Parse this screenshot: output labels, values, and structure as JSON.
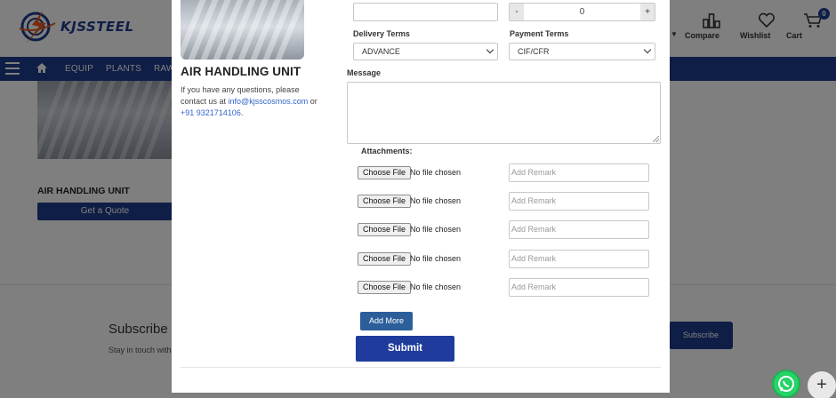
{
  "brand": {
    "logo_text": "KJSSTEEL"
  },
  "header": {
    "compare_label": "Compare",
    "wishlist_label": "Wishlist",
    "cart_label": "Cart",
    "cart_count": "0"
  },
  "nav": {
    "items": [
      "EQUIP",
      "PLANTS",
      "RAW"
    ]
  },
  "background": {
    "product_title": "AIR HANDLING UNIT",
    "quote_button": "Get a Quote",
    "subscribe_title": "Subscribe",
    "subscribe_text": "Stay in touch with",
    "subscribe_button": "Subscribe"
  },
  "modal": {
    "product_name": "AIR HANDLING UNIT",
    "contact_prefix": "If you have any questions, please contact us at",
    "contact_email": "info@kjsscosmos.com",
    "contact_or": "or",
    "contact_phone": "+91 9321714106",
    "contact_period": ".",
    "quantity": {
      "minus": "-",
      "value": "0",
      "plus": "+"
    },
    "delivery_terms_label": "Delivery Terms",
    "delivery_terms_value": "ADVANCE",
    "payment_terms_label": "Payment Terms",
    "payment_terms_value": "CIF/CFR",
    "message_label": "Message",
    "attachments_label": "Attachments:",
    "choose_file_label": "Choose File",
    "no_file_label": "No file chosen",
    "remark_placeholder": "Add Remark",
    "add_more_label": "Add More",
    "submit_label": "Submit"
  },
  "colors": {
    "brand_blue": "#1f3c8c",
    "button_blue": "#1f3c9c",
    "add_more_blue": "#2c5f9a",
    "whatsapp_green": "#25d366"
  }
}
